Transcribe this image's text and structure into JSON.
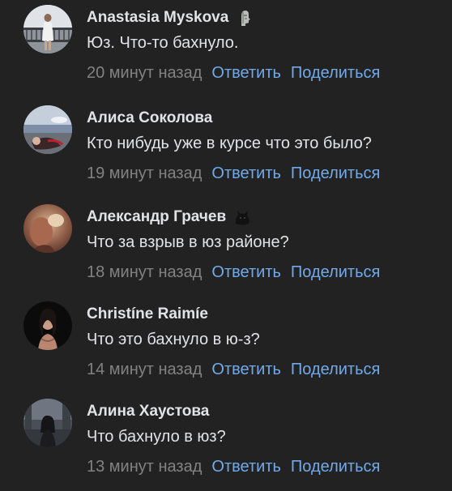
{
  "colors": {
    "background": "#222222",
    "text": "#e1e3e6",
    "muted": "#828282",
    "link": "#71aaeb"
  },
  "comments": [
    {
      "author": "Anastasia Myskova",
      "badge_icon": "statue-head-icon",
      "text": "Юз. Что-то бахнуло.",
      "time": "20 минут назад",
      "reply_label": "Ответить",
      "share_label": "Поделиться"
    },
    {
      "author": "Алиса Соколова",
      "text": "Кто нибудь уже в курсе что это было?",
      "time": "19 минут назад",
      "reply_label": "Ответить",
      "share_label": "Поделиться"
    },
    {
      "author": "Александр Грачев",
      "badge_icon": "black-cat-icon",
      "text": "Что за взрыв в юз районе?",
      "time": "18 минут назад",
      "reply_label": "Ответить",
      "share_label": "Поделиться"
    },
    {
      "author": "Christíne Raimíe",
      "text": "Что это бахнуло в ю-з?",
      "time": "14 минут назад",
      "reply_label": "Ответить",
      "share_label": "Поделиться"
    },
    {
      "author": "Алина Хаустова",
      "text": "Что бахнуло в юз?",
      "time": "13 минут назад",
      "reply_label": "Ответить",
      "share_label": "Поделиться"
    }
  ]
}
